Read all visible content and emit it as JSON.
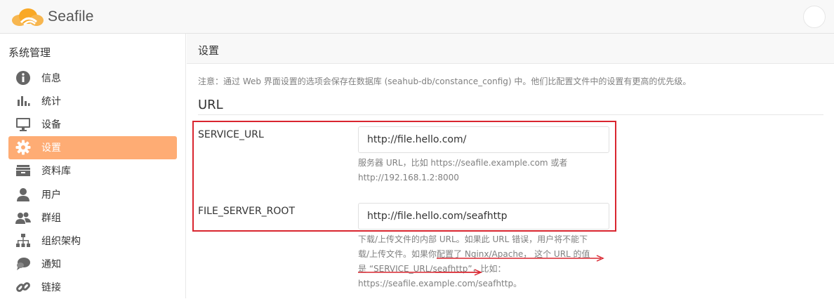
{
  "app": {
    "name": "Seafile"
  },
  "sidebar": {
    "title": "系统管理",
    "items": [
      {
        "label": "信息",
        "icon": "info-icon"
      },
      {
        "label": "统计",
        "icon": "bar-chart-icon"
      },
      {
        "label": "设备",
        "icon": "monitor-icon"
      },
      {
        "label": "设置",
        "icon": "gear-icon",
        "active": true
      },
      {
        "label": "资料库",
        "icon": "library-icon"
      },
      {
        "label": "用户",
        "icon": "user-icon"
      },
      {
        "label": "群组",
        "icon": "group-icon"
      },
      {
        "label": "组织架构",
        "icon": "org-chart-icon"
      },
      {
        "label": "通知",
        "icon": "chat-bubble-icon"
      },
      {
        "label": "链接",
        "icon": "link-icon"
      }
    ]
  },
  "main": {
    "title": "设置",
    "notice": "注意：通过 Web 界面设置的选项会保存在数据库 (seahub-db/constance_config) 中。他们比配置文件中的设置有更高的优先级。",
    "section": "URL",
    "fields": [
      {
        "label": "SERVICE_URL",
        "value": "http://file.hello.com/",
        "help_lines": [
          "服务器 URL，比如 https://seafile.example.com 或者",
          "http://192.168.1.2:8000"
        ]
      },
      {
        "label": "FILE_SERVER_ROOT",
        "value": "http://file.hello.com/seafhttp",
        "help_lines": [
          "下载/上传文件的内部 URL。如果此 URL 错误，用户将不能下",
          "载/上传文件。如果你配置了 Nginx/Apache， 这个 URL 的值",
          "是 “SERVICE_URL/seafhttp”，比如：",
          "https://seafile.example.com/seafhttp。"
        ]
      }
    ]
  },
  "colors": {
    "accent": "#feac74",
    "annotation": "#d9252f",
    "logo": "#f7b64f"
  }
}
